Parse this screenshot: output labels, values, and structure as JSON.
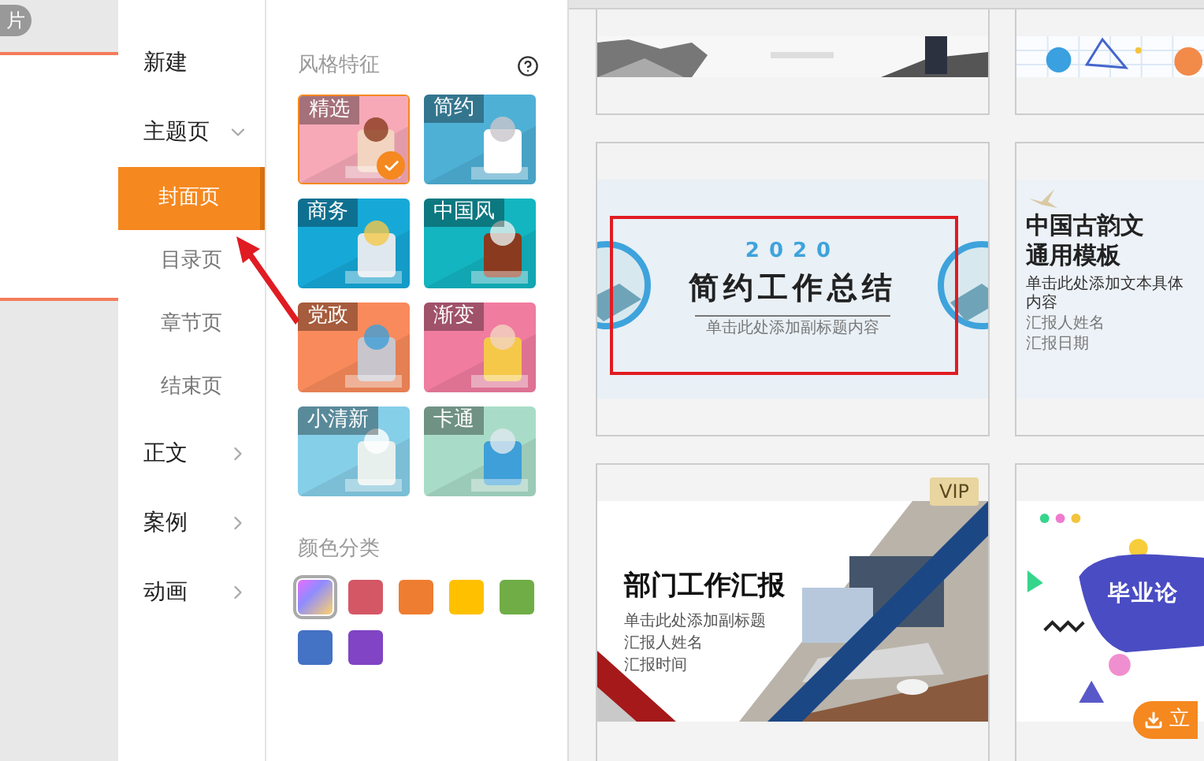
{
  "left_slide": {
    "tab_label": "片"
  },
  "menu": {
    "items": [
      {
        "label": "新建",
        "kind": "action"
      },
      {
        "label": "主题页",
        "kind": "group",
        "expanded": true,
        "children": [
          {
            "label": "封面页",
            "selected": true
          },
          {
            "label": "目录页",
            "selected": false
          },
          {
            "label": "章节页",
            "selected": false
          },
          {
            "label": "结束页",
            "selected": false
          }
        ]
      },
      {
        "label": "正文",
        "kind": "group",
        "expanded": false
      },
      {
        "label": "案例",
        "kind": "group",
        "expanded": false
      },
      {
        "label": "动画",
        "kind": "group",
        "expanded": false
      }
    ]
  },
  "styles": {
    "title": "风格特征",
    "tiles": [
      {
        "label": "精选",
        "selected": true
      },
      {
        "label": "简约",
        "selected": false
      },
      {
        "label": "商务",
        "selected": false
      },
      {
        "label": "中国风",
        "selected": false
      },
      {
        "label": "党政",
        "selected": false
      },
      {
        "label": "渐变",
        "selected": false
      },
      {
        "label": "小清新",
        "selected": false
      },
      {
        "label": "卡通",
        "selected": false
      }
    ]
  },
  "colors": {
    "title": "颜色分类",
    "swatches": [
      {
        "kind": "gradient",
        "selected": true
      },
      {
        "kind": "solid",
        "color": "#d45766",
        "selected": false
      },
      {
        "kind": "solid",
        "color": "#ee7d31",
        "selected": false
      },
      {
        "kind": "solid",
        "color": "#ffc000",
        "selected": false
      },
      {
        "kind": "solid",
        "color": "#70ad47",
        "selected": false
      },
      {
        "kind": "solid",
        "color": "#4472c4",
        "selected": false
      },
      {
        "kind": "solid",
        "color": "#8044c4",
        "selected": false
      }
    ]
  },
  "templates": [
    {
      "kind": "ink"
    },
    {
      "kind": "doodle"
    },
    {
      "kind": "simple",
      "year": "2020",
      "title": "简约工作总结",
      "subtitle": "单击此处添加副标题内容"
    },
    {
      "kind": "classic",
      "title_lines": [
        "中国古韵文",
        "通用模板"
      ],
      "subtitle": "单击此处添加文本具体内容",
      "lines": [
        "汇报人姓名",
        "汇报日期"
      ]
    },
    {
      "kind": "business",
      "badge": "VIP",
      "title": "部门工作汇报",
      "subtitle": "单击此处添加副标题",
      "lines": [
        "汇报人姓名",
        "汇报时间"
      ]
    },
    {
      "kind": "graduation",
      "title": "毕业论",
      "button": "立"
    }
  ]
}
